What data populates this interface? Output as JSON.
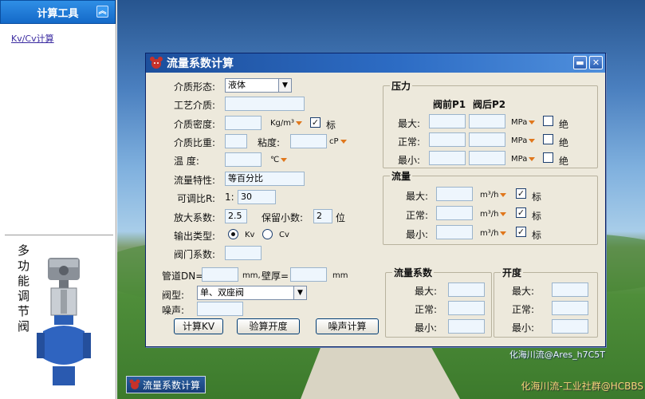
{
  "sidebar": {
    "header": "计算工具",
    "link": "Kv/Cv计算",
    "vertical_text": "多功能调节阀"
  },
  "desktop": {
    "watermark1": "化海川流@Ares_h7C5T",
    "watermark2": "化海川流-工业社群@HCBBS",
    "taskbar_label": "流量系数计算"
  },
  "window": {
    "title": "流量系数计算",
    "minimize": "▬",
    "close": "✕",
    "form": {
      "medium_state_label": "介质形态:",
      "medium_state_value": "液体",
      "process_medium_label": "工艺介质:",
      "density_label": "介质密度:",
      "density_unit": "Kg/m³",
      "density_std_check": "✓",
      "density_std_label": "标",
      "sg_label": "介质比重:",
      "viscosity_label": "粘度:",
      "viscosity_unit": "cP",
      "temp_label": "温    度:",
      "temp_unit": "℃",
      "flow_char_label": "流量特性:",
      "flow_char_value": "等百分比",
      "rangeability_label": "可调比R:",
      "rangeability_prefix": "1:",
      "rangeability_value": "30",
      "amp_label": "放大系数:",
      "amp_value": "2.5",
      "decimals_label": "保留小数:",
      "decimals_value": "2",
      "decimals_unit": "位",
      "output_label": "输出类型:",
      "output_opt1": "Kv",
      "output_opt2": "Cv",
      "valve_coef_label": "阀门系数:",
      "pipe_dn_label": "管道DN=",
      "pipe_dn_unit": "mm,",
      "wall_label": "壁厚=",
      "wall_unit": "mm",
      "valve_type_label": "阀型:",
      "valve_type_value": "单、双座阀",
      "noise_label": "噪声:"
    },
    "pressure": {
      "title": "压力",
      "col1": "阀前P1",
      "col2": "阀后P2",
      "rows": [
        {
          "label": "最大:",
          "unit": "MPa",
          "abs": "绝"
        },
        {
          "label": "正常:",
          "unit": "MPa",
          "abs": "绝"
        },
        {
          "label": "最小:",
          "unit": "MPa",
          "abs": "绝"
        }
      ]
    },
    "flow": {
      "title": "流量",
      "rows": [
        {
          "label": "最大:",
          "unit": "m³/h",
          "check": "✓",
          "std": "标"
        },
        {
          "label": "正常:",
          "unit": "m³/h",
          "check": "✓",
          "std": "标"
        },
        {
          "label": "最小:",
          "unit": "m³/h",
          "check": "✓",
          "std": "标"
        }
      ]
    },
    "coef": {
      "title": "流量系数",
      "rows": [
        "最大:",
        "正常:",
        "最小:"
      ]
    },
    "opening": {
      "title": "开度",
      "rows": [
        "最大:",
        "正常:",
        "最小:"
      ]
    },
    "buttons": {
      "calc_kv": "计算KV",
      "check_opening": "验算开度",
      "noise_calc": "噪声计算"
    }
  }
}
